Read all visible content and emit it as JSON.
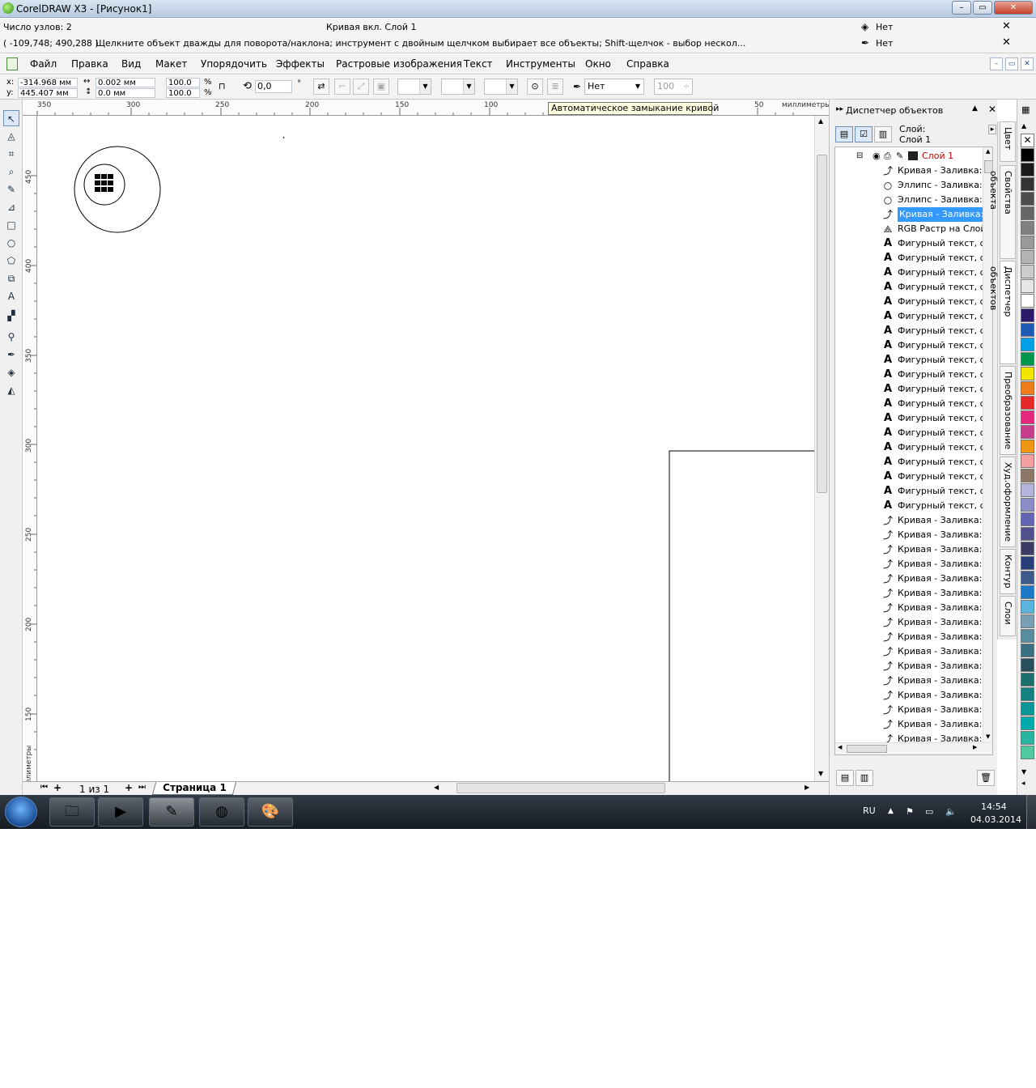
{
  "window": {
    "title": "CorelDRAW X3 - [Рисунок1]",
    "minimize": "–",
    "maximize": "▭",
    "close": "✕"
  },
  "status": {
    "nodes": "Число узлов: 2",
    "object_info": "Кривая вкл. Слой 1",
    "coords": "( -109,748; 490,288 )",
    "hint": "Щелкните объект дважды для поворота/наклона; инструмент с двойным щелчком выбирает все объекты; Shift-щелчок - выбор нескол...",
    "fill_label": "Нет",
    "outline_label": "Нет"
  },
  "menu": {
    "items": [
      "Файл",
      "Правка",
      "Вид",
      "Макет",
      "Упорядочить",
      "Эффекты",
      "Растровые изображения",
      "Текст",
      "Инструменты",
      "Окно",
      "Справка"
    ]
  },
  "propbar": {
    "x_label": "x:",
    "x_value": "-314.968 мм",
    "y_label": "y:",
    "y_value": "445.407 мм",
    "width_value": "0.002 мм",
    "height_value": "0.0 мм",
    "scale_x": "100.0",
    "scale_y": "100.0",
    "percent1": "%",
    "percent2": "%",
    "angle_value": "0,0",
    "angle_unit": "°",
    "outline_width": "Нет",
    "smoothing": "100"
  },
  "ruler": {
    "h_labels": [
      "350",
      "300",
      "250",
      "200",
      "150",
      "100",
      "50"
    ],
    "unit": "миллиметры",
    "v_labels": [
      "450",
      "400",
      "350",
      "300",
      "250",
      "200",
      "150"
    ],
    "v_unit": "миллиметры"
  },
  "tooltip": "Автоматическое замыкание кривой",
  "pagenav": {
    "count": "1 из 1",
    "page_tab": "Страница 1"
  },
  "docker": {
    "title": "Диспетчер объектов",
    "layer_label": "Слой:",
    "layer_name": "Слой 1",
    "layer_node": "Слой 1",
    "rows": [
      {
        "icon": "curve-icon",
        "text": "Кривая - Заливка:"
      },
      {
        "icon": "ellipse-icon",
        "text": "Эллипс - Заливка:"
      },
      {
        "icon": "ellipse-icon",
        "text": "Эллипс - Заливка:"
      },
      {
        "icon": "curve-icon",
        "text": "Кривая - Заливка:",
        "selected": true
      },
      {
        "icon": "bitmap-icon",
        "text": "RGB Растр на Слой"
      },
      {
        "icon": "text-icon",
        "text": "Фигурный текст, сл"
      },
      {
        "icon": "text-icon",
        "text": "Фигурный текст, сл"
      },
      {
        "icon": "text-icon",
        "text": "Фигурный текст, сл"
      },
      {
        "icon": "text-icon",
        "text": "Фигурный текст, сл"
      },
      {
        "icon": "text-icon",
        "text": "Фигурный текст, сл"
      },
      {
        "icon": "text-icon",
        "text": "Фигурный текст, сл"
      },
      {
        "icon": "text-icon",
        "text": "Фигурный текст, сл"
      },
      {
        "icon": "text-icon",
        "text": "Фигурный текст, сл"
      },
      {
        "icon": "text-icon",
        "text": "Фигурный текст, сл"
      },
      {
        "icon": "text-icon",
        "text": "Фигурный текст, сл"
      },
      {
        "icon": "text-icon",
        "text": "Фигурный текст, сл"
      },
      {
        "icon": "text-icon",
        "text": "Фигурный текст, сл"
      },
      {
        "icon": "text-icon",
        "text": "Фигурный текст, сл"
      },
      {
        "icon": "text-icon",
        "text": "Фигурный текст, сл"
      },
      {
        "icon": "text-icon",
        "text": "Фигурный текст, сл"
      },
      {
        "icon": "text-icon",
        "text": "Фигурный текст, сл"
      },
      {
        "icon": "text-icon",
        "text": "Фигурный текст, сл"
      },
      {
        "icon": "text-icon",
        "text": "Фигурный текст, сл"
      },
      {
        "icon": "text-icon",
        "text": "Фигурный текст, сл"
      },
      {
        "icon": "curve-icon",
        "text": "Кривая - Заливка:"
      },
      {
        "icon": "curve-icon",
        "text": "Кривая - Заливка:"
      },
      {
        "icon": "curve-icon",
        "text": "Кривая - Заливка:"
      },
      {
        "icon": "curve-icon",
        "text": "Кривая - Заливка:"
      },
      {
        "icon": "curve-icon",
        "text": "Кривая - Заливка:"
      },
      {
        "icon": "curve-icon",
        "text": "Кривая - Заливка:"
      },
      {
        "icon": "curve-icon",
        "text": "Кривая - Заливка:"
      },
      {
        "icon": "curve-icon",
        "text": "Кривая - Заливка:"
      },
      {
        "icon": "curve-icon",
        "text": "Кривая - Заливка:"
      },
      {
        "icon": "curve-icon",
        "text": "Кривая - Заливка:"
      },
      {
        "icon": "curve-icon",
        "text": "Кривая - Заливка:"
      },
      {
        "icon": "curve-icon",
        "text": "Кривая - Заливка:"
      },
      {
        "icon": "curve-icon",
        "text": "Кривая - Заливка:"
      },
      {
        "icon": "curve-icon",
        "text": "Кривая - Заливка:"
      },
      {
        "icon": "curve-icon",
        "text": "Кривая - Заливка:"
      },
      {
        "icon": "curve-icon",
        "text": "Кривая - Заливка:"
      }
    ]
  },
  "sidetabs": [
    "Цвет",
    "Свойства объекта",
    "Диспетчер объектов",
    "Преобразование",
    "Худ.оформление",
    "Контур",
    "Слои"
  ],
  "palette": [
    "#000000",
    "#1a1a1a",
    "#333333",
    "#4d4d4d",
    "#666666",
    "#808080",
    "#999999",
    "#b3b3b3",
    "#cccccc",
    "#e6e6e6",
    "#ffffff",
    "#2e1a6b",
    "#1e5ab4",
    "#00a0e6",
    "#00964b",
    "#f0e600",
    "#ef7d1a",
    "#e62828",
    "#e6287d",
    "#c83c8c",
    "#ef9614",
    "#f5a0a0",
    "#8c7864",
    "#b4b4dc",
    "#8c8cc8",
    "#6464b4",
    "#50508c",
    "#3c3c64",
    "#283c78",
    "#3c5a8c",
    "#1e78c8",
    "#5ab4dc",
    "#78a0b4",
    "#5a8ca0",
    "#3c6e82",
    "#28505a",
    "#1e6e6e",
    "#148282",
    "#0a9696",
    "#00aaaa",
    "#28b4a0",
    "#50c8a0"
  ],
  "taskbar": {
    "lang": "RU",
    "time": "14:54",
    "date": "04.03.2014"
  }
}
